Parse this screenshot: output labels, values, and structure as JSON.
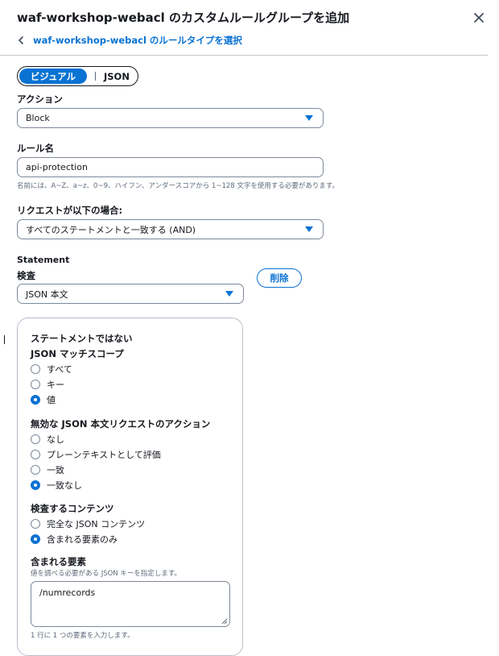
{
  "header": {
    "title": "waf-workshop-webacl のカスタムルールグループを追加",
    "back_link": "waf-workshop-webacl のルールタイプを選択"
  },
  "editor_mode": {
    "visual": "ビジュアル",
    "json": "JSON",
    "selected": "visual"
  },
  "action": {
    "label": "アクション",
    "value": "Block"
  },
  "rule_name": {
    "label": "ルール名",
    "value": "api-protection",
    "hint": "名前には、A~Z、a~z、0~9、ハイフン、アンダースコアから 1~128 文字を使用する必要があります。"
  },
  "request_condition": {
    "label": "リクエストが以下の場合:",
    "value": "すべてのステートメントと一致する (AND)"
  },
  "statement": {
    "heading": "Statement",
    "inspect_label": "検査",
    "inspect_value": "JSON 本文",
    "delete_label": "削除"
  },
  "panel": {
    "negate_label": "ステートメントではない",
    "match_scope": {
      "label": "JSON マッチスコープ",
      "options": [
        "すべて",
        "キー",
        "値"
      ],
      "selected": 2
    },
    "invalid_body_action": {
      "label": "無効な JSON 本文リクエストのアクション",
      "options": [
        "なし",
        "プレーンテキストとして評価",
        "一致",
        "一致なし"
      ],
      "selected": 3
    },
    "content_to_inspect": {
      "label": "検査するコンテンツ",
      "options": [
        "完全な JSON コンテンツ",
        "含まれる要素のみ"
      ],
      "selected": 1
    },
    "included_elements": {
      "label": "含まれる要素",
      "description": "値を調べる必要がある JSON キーを指定します。",
      "value": "/numrecords",
      "hint": "1 行に 1 つの要素を入力します。"
    }
  },
  "colors": {
    "accent": "#0972d3",
    "text": "#16191f",
    "muted": "#5f6b7a",
    "border": "#7d8998"
  }
}
